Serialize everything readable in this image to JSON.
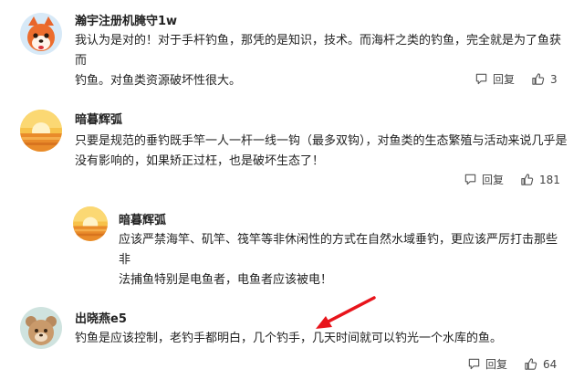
{
  "comments": [
    {
      "username": "瀚宇注册机腌守1w",
      "avatar_icon": "fox-avatar-icon",
      "lines": [
        "我认为是对的！对于手杆钓鱼，那凭的是知识，技术。而海杆之类的钓鱼，完全就是为了鱼获而",
        "钓鱼。对鱼类资源破坏性很大。"
      ],
      "reply_label": "回复",
      "likes": "3"
    },
    {
      "username": "暗暮辉弧",
      "avatar_icon": "sunset-avatar-icon",
      "lines": [
        "只要是规范的垂钓既手竿一人一杆一线一钩（最多双钩），对鱼类的生态繁殖与活动来说几乎是",
        "没有影响的，如果矫正过枉，也是破坏生态了！"
      ],
      "reply_label": "回复",
      "likes": "181"
    },
    {
      "username": "暗暮辉弧",
      "avatar_icon": "sunset-avatar-icon",
      "lines": [
        "应该严禁海竿、矶竿、筏竿等非休闲性的方式在自然水域垂钓，更应该严厉打击那些非",
        "法捕鱼特别是电鱼者，电鱼者应该被电！"
      ]
    },
    {
      "username": "出晓燕e5",
      "avatar_icon": "bear-avatar-icon",
      "lines": [
        "钓鱼是应该控制，老钓手都明白，几个钓手，几天时间就可以钓光一个水库的鱼。"
      ],
      "reply_label": "回复",
      "likes": "64"
    }
  ],
  "icons": {
    "reply": "comment-bubble-icon",
    "like": "thumbs-up-icon",
    "annotation": "red-arrow-icon"
  },
  "colors": {
    "annotation_arrow": "#e8141b",
    "text": "#222222",
    "action_text": "#444444"
  }
}
